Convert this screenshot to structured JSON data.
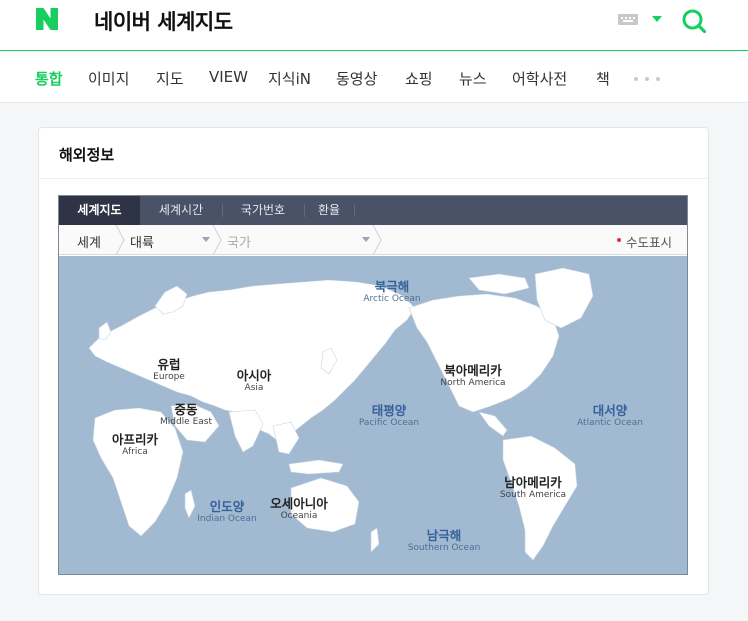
{
  "header": {
    "logo_letter": "N",
    "title": "네이버 세계지도",
    "brand_color": "#19ce60"
  },
  "tabs": [
    {
      "label": "통합",
      "active": true
    },
    {
      "label": "이미지"
    },
    {
      "label": "지도"
    },
    {
      "label": "VIEW"
    },
    {
      "label": "지식iN"
    },
    {
      "label": "동영상"
    },
    {
      "label": "쇼핑"
    },
    {
      "label": "뉴스"
    },
    {
      "label": "어학사전"
    },
    {
      "label": "책"
    }
  ],
  "card": {
    "title": "해외정보"
  },
  "widget": {
    "tabs": [
      "세계지도",
      "세계시간",
      "국가번호",
      "환율"
    ],
    "active_tab": "세계지도",
    "breadcrumb": {
      "root": "세계",
      "region_select": "대륙",
      "country_select_placeholder": "국가"
    },
    "capital_toggle": "수도표시"
  },
  "map": {
    "land_color": "#ffffff",
    "sea_color": "#a1b9d1",
    "continents": [
      {
        "ko": "유럽",
        "en": "Europe"
      },
      {
        "ko": "아시아",
        "en": "Asia"
      },
      {
        "ko": "중동",
        "en": "Middle East"
      },
      {
        "ko": "아프리카",
        "en": "Africa"
      },
      {
        "ko": "오세아니아",
        "en": "Oceania"
      },
      {
        "ko": "북아메리카",
        "en": "North America"
      },
      {
        "ko": "남아메리카",
        "en": "South America"
      }
    ],
    "oceans": [
      {
        "ko": "북극해",
        "en": "Arctic Ocean"
      },
      {
        "ko": "태평양",
        "en": "Pacific Ocean"
      },
      {
        "ko": "대서양",
        "en": "Atlantic Ocean"
      },
      {
        "ko": "인도양",
        "en": "Indian Ocean"
      },
      {
        "ko": "남극해",
        "en": "Southern Ocean"
      }
    ]
  }
}
